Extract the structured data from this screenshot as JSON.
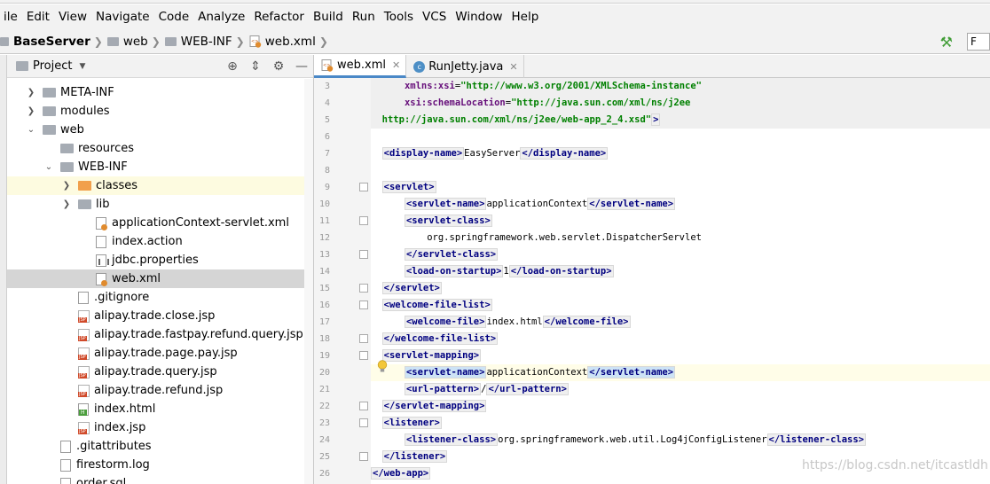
{
  "menu": [
    "ile",
    "Edit",
    "View",
    "Navigate",
    "Code",
    "Analyze",
    "Refactor",
    "Build",
    "Run",
    "Tools",
    "VCS",
    "Window",
    "Help"
  ],
  "breadcrumb": [
    "BaseServer",
    "web",
    "WEB-INF",
    "web.xml"
  ],
  "toolbar": {
    "run_config": "F"
  },
  "project_panel": {
    "title": "Project"
  },
  "tree": [
    {
      "label": "META-INF",
      "icon": "folder",
      "arrow": "right",
      "depth": 1
    },
    {
      "label": "modules",
      "icon": "folder",
      "arrow": "right",
      "depth": 1
    },
    {
      "label": "web",
      "icon": "folder",
      "arrow": "down",
      "depth": 1
    },
    {
      "label": "resources",
      "icon": "folder",
      "arrow": "",
      "depth": 2
    },
    {
      "label": "WEB-INF",
      "icon": "folder",
      "arrow": "down",
      "depth": 2
    },
    {
      "label": "classes",
      "icon": "folder-orange",
      "arrow": "right",
      "depth": 3,
      "highlight": "yellow"
    },
    {
      "label": "lib",
      "icon": "folder",
      "arrow": "right",
      "depth": 3
    },
    {
      "label": "applicationContext-servlet.xml",
      "icon": "xml-file",
      "arrow": "",
      "depth": 4
    },
    {
      "label": "index.action",
      "icon": "file",
      "arrow": "",
      "depth": 4
    },
    {
      "label": "jdbc.properties",
      "icon": "properties-file",
      "arrow": "",
      "depth": 4
    },
    {
      "label": "web.xml",
      "icon": "xml-file",
      "arrow": "",
      "depth": 4,
      "highlight": "selected"
    },
    {
      "label": ".gitignore",
      "icon": "file",
      "arrow": "",
      "depth": 3
    },
    {
      "label": "alipay.trade.close.jsp",
      "icon": "jsp-file",
      "arrow": "",
      "depth": 3
    },
    {
      "label": "alipay.trade.fastpay.refund.query.jsp",
      "icon": "jsp-file",
      "arrow": "",
      "depth": 3
    },
    {
      "label": "alipay.trade.page.pay.jsp",
      "icon": "jsp-file",
      "arrow": "",
      "depth": 3
    },
    {
      "label": "alipay.trade.query.jsp",
      "icon": "jsp-file",
      "arrow": "",
      "depth": 3
    },
    {
      "label": "alipay.trade.refund.jsp",
      "icon": "jsp-file",
      "arrow": "",
      "depth": 3
    },
    {
      "label": "index.html",
      "icon": "html-file",
      "arrow": "",
      "depth": 3
    },
    {
      "label": "index.jsp",
      "icon": "jsp-file",
      "arrow": "",
      "depth": 3
    },
    {
      "label": ".gitattributes",
      "icon": "file",
      "arrow": "",
      "depth": 2
    },
    {
      "label": "firestorm.log",
      "icon": "file",
      "arrow": "",
      "depth": 2
    },
    {
      "label": "order.sql",
      "icon": "file",
      "arrow": "",
      "depth": 2
    }
  ],
  "tabs": [
    {
      "label": "web.xml",
      "active": true
    },
    {
      "label": "RunJetty.java",
      "active": false
    }
  ],
  "code": [
    {
      "n": "3",
      "shade": true,
      "parts": [
        [
          "t",
          "      "
        ],
        [
          "a",
          "xmlns:xsi"
        ],
        [
          "t",
          "="
        ],
        [
          "s",
          "\"http://www.w3.org/2001/XMLSchema-instance\""
        ]
      ]
    },
    {
      "n": "4",
      "shade": true,
      "parts": [
        [
          "t",
          "      "
        ],
        [
          "a",
          "xsi:schemaLocation"
        ],
        [
          "t",
          "="
        ],
        [
          "s",
          "\"http://java.sun.com/xml/ns/j2ee"
        ]
      ]
    },
    {
      "n": "5",
      "shade": true,
      "parts": [
        [
          "t",
          "  "
        ],
        [
          "s",
          "http://java.sun.com/xml/ns/j2ee/web-app_2_4.xsd\""
        ],
        [
          "g",
          ">"
        ]
      ]
    },
    {
      "n": "6",
      "parts": []
    },
    {
      "n": "7",
      "parts": [
        [
          "t",
          "  "
        ],
        [
          "g",
          "<display-name>"
        ],
        [
          "t",
          "EasyServer"
        ],
        [
          "g",
          "</display-name>"
        ]
      ]
    },
    {
      "n": "8",
      "parts": []
    },
    {
      "n": "9",
      "parts": [
        [
          "t",
          "  "
        ],
        [
          "g",
          "<servlet>"
        ]
      ]
    },
    {
      "n": "10",
      "parts": [
        [
          "t",
          "      "
        ],
        [
          "g",
          "<servlet-name>"
        ],
        [
          "t",
          "applicationContext"
        ],
        [
          "g",
          "</servlet-name>"
        ]
      ]
    },
    {
      "n": "11",
      "parts": [
        [
          "t",
          "      "
        ],
        [
          "g",
          "<servlet-class>"
        ]
      ]
    },
    {
      "n": "12",
      "parts": [
        [
          "t",
          "          org.springframework.web.servlet.DispatcherServlet"
        ]
      ]
    },
    {
      "n": "13",
      "parts": [
        [
          "t",
          "      "
        ],
        [
          "g",
          "</servlet-class>"
        ]
      ]
    },
    {
      "n": "14",
      "parts": [
        [
          "t",
          "      "
        ],
        [
          "g",
          "<load-on-startup>"
        ],
        [
          "t",
          "1"
        ],
        [
          "g",
          "</load-on-startup>"
        ]
      ]
    },
    {
      "n": "15",
      "parts": [
        [
          "t",
          "  "
        ],
        [
          "g",
          "</servlet>"
        ]
      ]
    },
    {
      "n": "16",
      "parts": [
        [
          "t",
          "  "
        ],
        [
          "g",
          "<welcome-file-list>"
        ]
      ]
    },
    {
      "n": "17",
      "parts": [
        [
          "t",
          "      "
        ],
        [
          "g",
          "<welcome-file>"
        ],
        [
          "t",
          "index.html"
        ],
        [
          "g",
          "</welcome-file>"
        ]
      ]
    },
    {
      "n": "18",
      "parts": [
        [
          "t",
          "  "
        ],
        [
          "g",
          "</welcome-file-list>"
        ]
      ]
    },
    {
      "n": "19",
      "parts": [
        [
          "t",
          "  "
        ],
        [
          "g",
          "<servlet-mapping>"
        ]
      ]
    },
    {
      "n": "20",
      "current": true,
      "parts": [
        [
          "t",
          "      "
        ],
        [
          "h",
          "<servlet-name>"
        ],
        [
          "t",
          "applicationContext"
        ],
        [
          "h",
          "</servlet-name>"
        ]
      ]
    },
    {
      "n": "21",
      "parts": [
        [
          "t",
          "      "
        ],
        [
          "g",
          "<url-pattern>"
        ],
        [
          "t",
          "/"
        ],
        [
          "g",
          "</url-pattern>"
        ]
      ]
    },
    {
      "n": "22",
      "parts": [
        [
          "t",
          "  "
        ],
        [
          "g",
          "</servlet-mapping>"
        ]
      ]
    },
    {
      "n": "23",
      "parts": [
        [
          "t",
          "  "
        ],
        [
          "g",
          "<listener>"
        ]
      ]
    },
    {
      "n": "24",
      "parts": [
        [
          "t",
          "      "
        ],
        [
          "g",
          "<listener-class>"
        ],
        [
          "t",
          "org.springframework.web.util.Log4jConfigListener"
        ],
        [
          "g",
          "</listener-class>"
        ]
      ]
    },
    {
      "n": "25",
      "parts": [
        [
          "t",
          "  "
        ],
        [
          "g",
          "</listener>"
        ]
      ]
    },
    {
      "n": "26",
      "parts": [
        [
          "g",
          "</web-app>"
        ]
      ]
    }
  ],
  "watermark": "https://blog.csdn.net/itcastldh"
}
